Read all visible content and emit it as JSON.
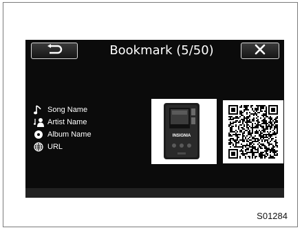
{
  "header": {
    "title": "Bookmark (5/50)",
    "back_icon": "back-arrow-icon",
    "close_icon": "close-icon"
  },
  "info": {
    "items": [
      {
        "icon": "music-note-icon",
        "label": "Song Name"
      },
      {
        "icon": "artist-icon",
        "label": "Artist Name"
      },
      {
        "icon": "album-disc-icon",
        "label": "Album Name"
      },
      {
        "icon": "globe-icon",
        "label": "URL"
      }
    ]
  },
  "media": {
    "album_art_brand": "INSIGNIA",
    "qr_code": "qr-code"
  },
  "figure": {
    "code": "S01284"
  },
  "colors": {
    "screen_bg": "#0b0b0b",
    "text": "#ffffff",
    "border": "#d8d8d8"
  }
}
